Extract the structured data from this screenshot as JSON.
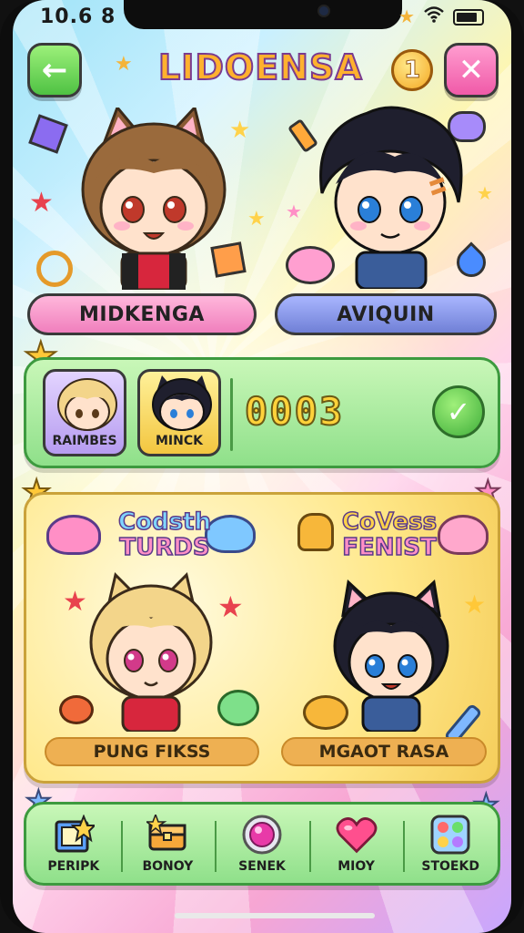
{
  "status_bar": {
    "time": "10.6 8"
  },
  "header": {
    "title": "LIDOENSA",
    "coin_value": "1",
    "back_icon": "arrow-left-icon",
    "close_icon": "close-icon"
  },
  "characters": {
    "left_name": "MIDKENGA",
    "right_name": "AVIQUIN"
  },
  "team": {
    "members": [
      {
        "label": "RAIMBES"
      },
      {
        "label": "MINCK"
      }
    ],
    "score": "0003",
    "confirm_icon": "check-icon"
  },
  "cards": {
    "left": {
      "title_line1": "Codsth",
      "title_line2": "TURDS",
      "button": "PUNG FIKSS"
    },
    "right": {
      "title_line1": "CoVess",
      "title_line2": "FENIST",
      "button": "MGAOT RASA"
    }
  },
  "bottom_nav": [
    {
      "label": "PERIPK",
      "icon": "book-icon"
    },
    {
      "label": "BONOY",
      "icon": "chest-icon"
    },
    {
      "label": "SENEK",
      "icon": "gem-icon"
    },
    {
      "label": "MIOY",
      "icon": "heart-icon"
    },
    {
      "label": "STOEKD",
      "icon": "sticker-grid-icon"
    }
  ],
  "colors": {
    "accent_green": "#4fc243",
    "accent_pink": "#f05aa8",
    "title_orange": "#ffb12e",
    "score_yellow": "#ffd23a"
  }
}
